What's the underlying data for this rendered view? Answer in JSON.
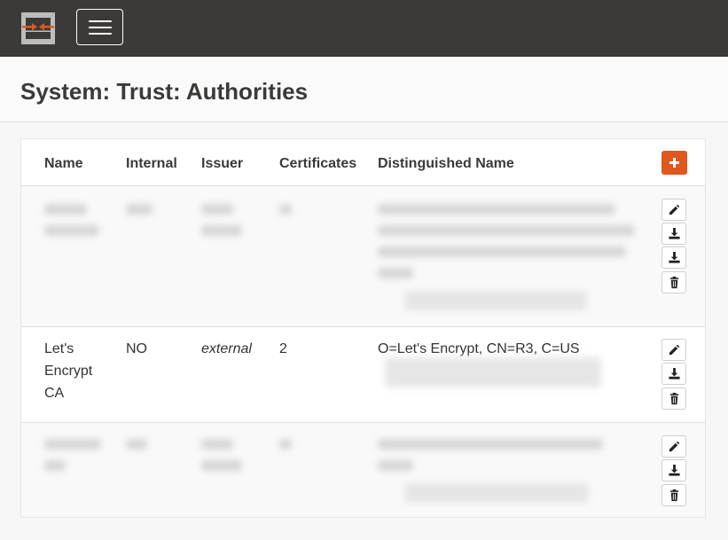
{
  "page": {
    "title": "System: Trust: Authorities"
  },
  "table": {
    "headers": [
      "Name",
      "Internal",
      "Issuer",
      "Certificates",
      "Distinguished Name"
    ],
    "rows": [
      {
        "name": "",
        "internal": "",
        "issuer": "",
        "certificates": "",
        "dn": ""
      },
      {
        "name": "Let's Encrypt CA",
        "internal": "NO",
        "issuer": "external",
        "certificates": "2",
        "dn": "O=Let's Encrypt, CN=R3, C=US"
      },
      {
        "name": "",
        "internal": "",
        "issuer": "",
        "certificates": "",
        "dn": ""
      }
    ]
  },
  "icons": {
    "logo": "opnsense-logo-icon",
    "menu": "hamburger-menu-icon",
    "add": "plus-icon",
    "edit": "pencil-icon",
    "download": "download-icon",
    "delete": "trash-icon"
  },
  "colors": {
    "topbar": "#3b3a38",
    "accent": "#e0571f"
  }
}
